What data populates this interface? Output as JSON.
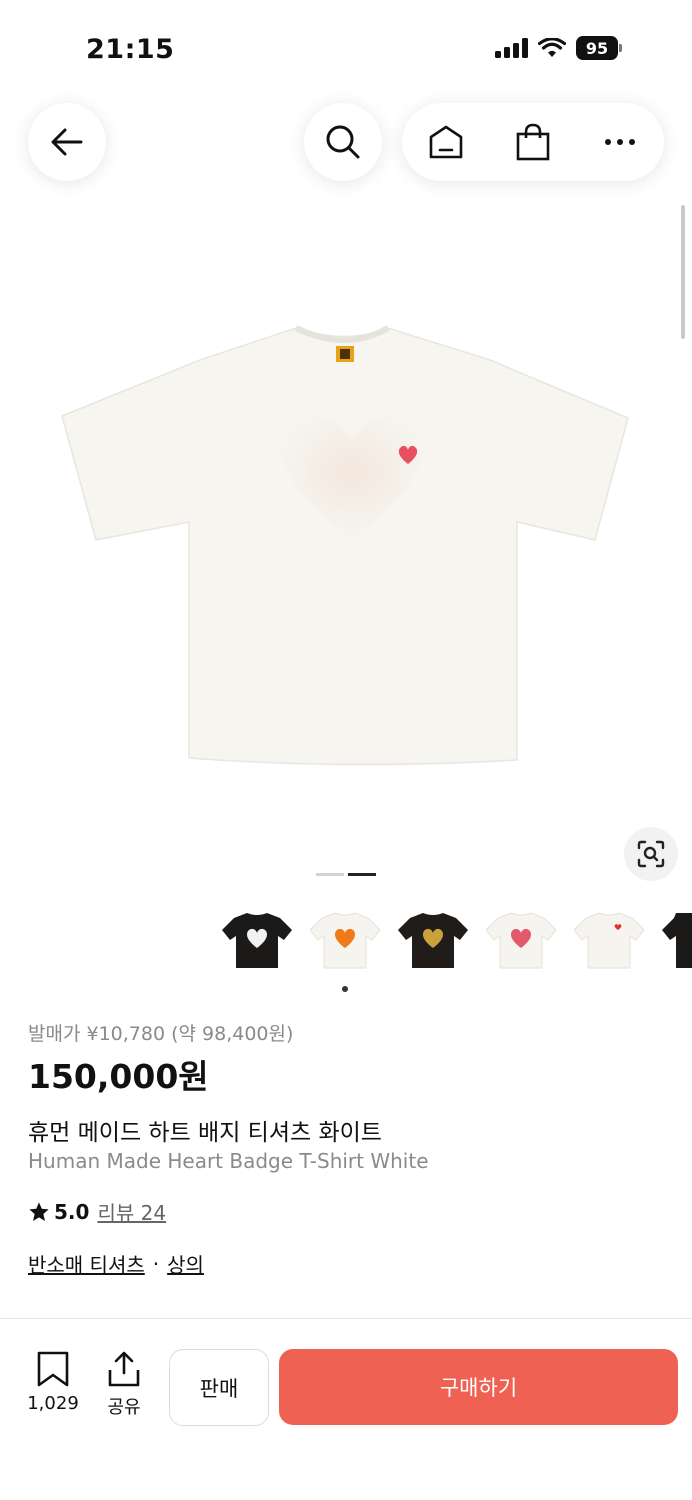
{
  "status_bar": {
    "time": "21:15",
    "battery": "95"
  },
  "icons": {
    "back": "arrow-left-icon",
    "search": "search-icon",
    "home": "home-icon",
    "cart": "shopping-bag-icon",
    "more": "more-icon",
    "lens": "visual-search-icon",
    "bookmark": "bookmark-icon",
    "share": "share-icon",
    "star": "star-icon"
  },
  "product": {
    "release_price": "발매가 ¥10,780 (약 98,400원)",
    "price": "150,000원",
    "name_ko": "휴먼 메이드 하트 배지 티셔츠 화이트",
    "name_en": "Human Made Heart Badge T-Shirt White",
    "rating": "5.0",
    "review_link": "리뷰 24",
    "category_1": "반소매 티셔츠",
    "separator": "·",
    "category_2": "상의"
  },
  "bottom_bar": {
    "bookmark_count": "1,029",
    "share_label": "공유",
    "sell_label": "판매",
    "buy_label": "구매하기"
  },
  "colors": {
    "accent": "#ef6253",
    "muted_text": "#8a8a8a",
    "shirt_white": "#f6f5f0"
  }
}
